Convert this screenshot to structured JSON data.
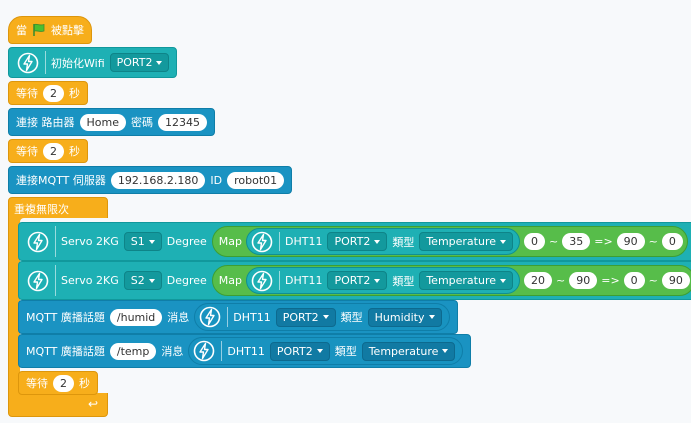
{
  "hat": {
    "label_1": "當",
    "label_2": "被點擊"
  },
  "init_wifi": {
    "label": "初始化Wifi",
    "port": "PORT2"
  },
  "wait_1": {
    "label": "等待",
    "value": "2",
    "unit": "秒"
  },
  "connect_router": {
    "label": "連接 路由器",
    "ssid": "Home",
    "password_label": "密碼",
    "password": "12345"
  },
  "wait_2": {
    "label": "等待",
    "value": "2",
    "unit": "秒"
  },
  "mqtt_connect": {
    "label": "連接MQTT 伺服器",
    "server": "192.168.2.180",
    "id_label": "ID",
    "id": "robot01"
  },
  "forever": {
    "label": "重複無限次"
  },
  "servo_1": {
    "label": "Servo 2KG",
    "port": "S1",
    "degree_label": "Degree",
    "map_label": "Map",
    "sensor": "DHT11",
    "sensor_port": "PORT2",
    "type_label": "類型",
    "type": "Temperature",
    "from_low": "0",
    "from_high": "35",
    "arrow": "=>",
    "to_low": "90",
    "to_high": "0",
    "tilde": "~"
  },
  "servo_2": {
    "label": "Servo 2KG",
    "port": "S2",
    "degree_label": "Degree",
    "map_label": "Map",
    "sensor": "DHT11",
    "sensor_port": "PORT2",
    "type_label": "類型",
    "type": "Temperature",
    "from_low": "20",
    "from_high": "90",
    "arrow": "=>",
    "to_low": "0",
    "to_high": "90",
    "tilde": "~"
  },
  "publish_1": {
    "label": "MQTT 廣播話題",
    "topic": "/humid",
    "msg_label": "消息",
    "sensor": "DHT11",
    "sensor_port": "PORT2",
    "type_label": "類型",
    "type": "Humidity"
  },
  "publish_2": {
    "label": "MQTT 廣播話題",
    "topic": "/temp",
    "msg_label": "消息",
    "sensor": "DHT11",
    "sensor_port": "PORT2",
    "type_label": "類型",
    "type": "Temperature"
  },
  "wait_3": {
    "label": "等待",
    "value": "2",
    "unit": "秒"
  },
  "icons": [
    "green-flag-icon",
    "lightning-icon",
    "caret-down-icon",
    "loop-arrow-icon"
  ],
  "colors": {
    "events": "#f7ae1b",
    "extension": "#1eb0b4",
    "mqtt": "#1a93c2",
    "operators": "#57bd4a",
    "background": "#f7f9fb"
  }
}
